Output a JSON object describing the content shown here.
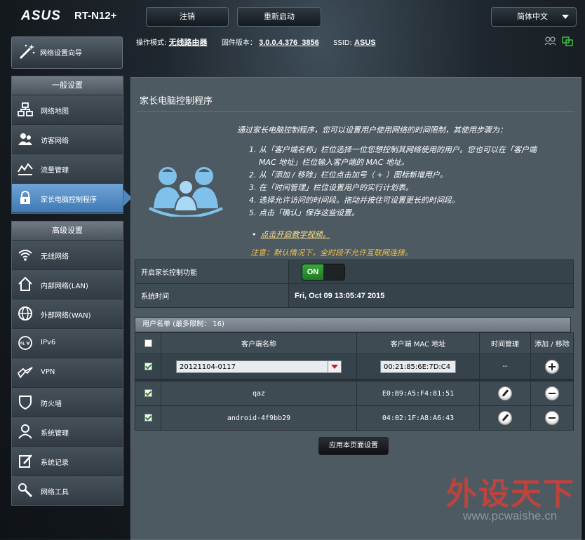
{
  "header": {
    "brand": "ASUS",
    "model": "RT-N12+",
    "logout_label": "注销",
    "reboot_label": "重新启动",
    "language": "简体中文"
  },
  "info": {
    "mode_label": "操作模式:",
    "mode_value": "无线路由器",
    "firmware_label": "固件版本：",
    "firmware_value": "3.0.0.4.376_3856",
    "ssid_label": "SSID:",
    "ssid_value": "ASUS"
  },
  "sidebar": {
    "qis_label": "网络设置向导",
    "general_header": "一般设置",
    "general_items": [
      {
        "label": "网络地图",
        "icon": "network-map-icon"
      },
      {
        "label": "访客网络",
        "icon": "guest-network-icon"
      },
      {
        "label": "流量管理",
        "icon": "traffic-manager-icon"
      },
      {
        "label": "家长电脑控制程序",
        "icon": "lock-icon"
      }
    ],
    "advanced_header": "高级设置",
    "advanced_items": [
      {
        "label": "无线网络",
        "icon": "wireless-icon"
      },
      {
        "label": "内部网络(LAN)",
        "icon": "house-icon"
      },
      {
        "label": "外部网络(WAN)",
        "icon": "globe-icon"
      },
      {
        "label": "IPv6",
        "icon": "ipv6-icon"
      },
      {
        "label": "VPN",
        "icon": "vpn-icon"
      },
      {
        "label": "防火墙",
        "icon": "shield-icon"
      },
      {
        "label": "系统管理",
        "icon": "user-admin-icon"
      },
      {
        "label": "系统记录",
        "icon": "log-icon"
      },
      {
        "label": "网络工具",
        "icon": "tools-icon"
      }
    ]
  },
  "main": {
    "title": "家长电脑控制程序",
    "intro": "通过家长电脑控制程序，您可以设置用户使用网络的时间限制，其使用步骤为：",
    "steps": [
      "1. 从「客户端名称」栏位选择一位您想控制其网络使用的用户。您也可以在「客户端",
      "MAC 地址」栏位输入客户端的 MAC 地址。",
      "2. 从「添加 / 移除」栏位点击加号（ + ）图标新增用户。",
      "3. 在「时间管理」栏位设置用户的实行计划表。",
      "4. 选择允许访问的时间段。拖动并按住可设置更长的时间段。",
      "5. 点击「确认」保存这些设置。"
    ],
    "tutorial_link": "点击开启教学视频。",
    "note": "注意：默认情况下，全时段不允许互联网连接。",
    "enable_label": "开启家长控制功能",
    "enable_state": "ON",
    "time_label": "系统时间",
    "time_value": "Fri, Oct 09 13:05:47 2015",
    "list_header": "用户名单 (最多限制： 16)",
    "columns": [
      "客户端名称",
      "客户端 MAC 地址",
      "时间管理",
      "添加 / 移除"
    ],
    "input_row": {
      "client": "20121104-0117",
      "mac": "00:21:85:6E:7D:C4",
      "time": "--"
    },
    "rows": [
      {
        "client": "qaz",
        "mac": "E0:B9:A5:F4:81:51"
      },
      {
        "client": "android-4f9bb29",
        "mac": "04:02:1F:A8:A6:43"
      }
    ],
    "apply_label": "应用本页面设置"
  },
  "watermark": {
    "text": "外设天下",
    "url": "www.pcwaishe.cn"
  }
}
